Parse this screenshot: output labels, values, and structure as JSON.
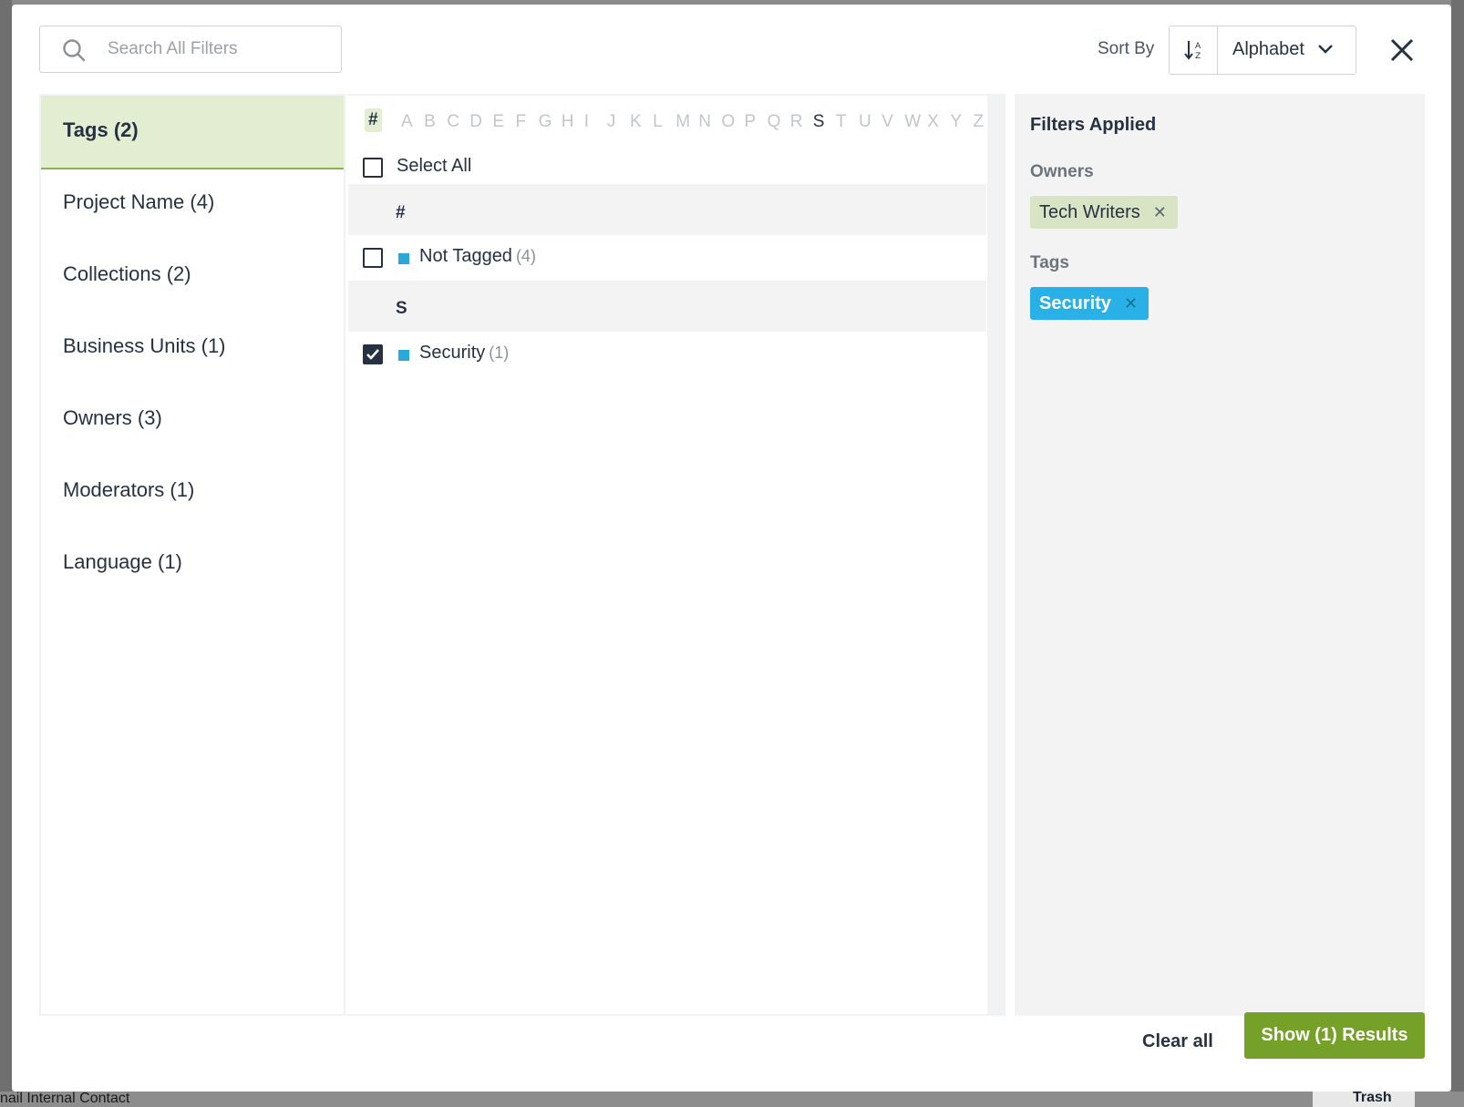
{
  "background": {
    "bottom_left_text": "nail Internal Contact",
    "bottom_trash_label": "Trash"
  },
  "search": {
    "placeholder": "Search All Filters",
    "icon": "search-icon"
  },
  "sort": {
    "label": "Sort By",
    "selected": "Alphabet",
    "icon": "sort-alpha-icon"
  },
  "categories": [
    {
      "label": "Tags (2)",
      "active": true
    },
    {
      "label": "Project Name (4)"
    },
    {
      "label": "Collections (2)"
    },
    {
      "label": "Business Units (1)"
    },
    {
      "label": "Owners (3)"
    },
    {
      "label": "Moderators (1)"
    },
    {
      "label": "Language (1)"
    }
  ],
  "alphabet": [
    "#",
    "A",
    "B",
    "C",
    "D",
    "E",
    "F",
    "G",
    "H",
    "I",
    "J",
    "K",
    "L",
    "M",
    "N",
    "O",
    "P",
    "Q",
    "R",
    "S",
    "T",
    "U",
    "V",
    "W",
    "X",
    "Y",
    "Z"
  ],
  "alphabet_active": "#",
  "alphabet_enabled": [
    "#",
    "S"
  ],
  "select_all_label": "Select All",
  "groups": [
    {
      "header": "#",
      "items": [
        {
          "name": "Not Tagged",
          "count": "(4)",
          "checked": false,
          "color": "#29a9d9"
        }
      ]
    },
    {
      "header": "S",
      "items": [
        {
          "name": "Security",
          "count": "(1)",
          "checked": true,
          "color": "#29a9d9"
        }
      ]
    }
  ],
  "applied": {
    "title": "Filters Applied",
    "owners_label": "Owners",
    "owners_chips": [
      "Tech Writers"
    ],
    "tags_label": "Tags",
    "tags_chips": [
      "Security"
    ],
    "remove_glyph": "✕"
  },
  "footer": {
    "clear_all": "Clear all",
    "show_results": "Show (1) Results"
  },
  "colors": {
    "accent_green": "#76a128",
    "active_bg": "#e3edd2",
    "tag_blue": "#29b0e6"
  }
}
